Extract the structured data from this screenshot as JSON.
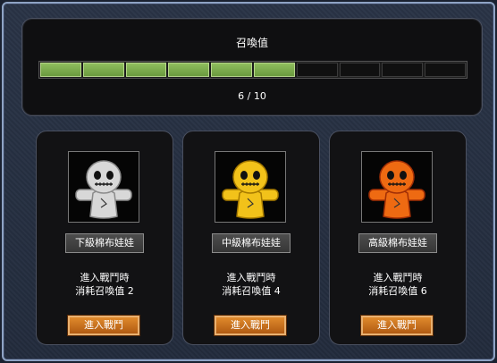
{
  "gauge": {
    "title": "召喚值",
    "filled": 6,
    "total": 10,
    "count_text": "6 / 10"
  },
  "cards": [
    {
      "name": "下級棉布娃娃",
      "line1": "進入戰鬥時",
      "line2": "消耗召喚值 2",
      "button": "進入戰鬥",
      "doll_color": "#d8d8d8",
      "doll_shade": "#8a8a8a"
    },
    {
      "name": "中級棉布娃娃",
      "line1": "進入戰鬥時",
      "line2": "消耗召喚值 4",
      "button": "進入戰鬥",
      "doll_color": "#f2c21a",
      "doll_shade": "#a67a00"
    },
    {
      "name": "高級棉布娃娃",
      "line1": "進入戰鬥時",
      "line2": "消耗召喚值 6",
      "button": "進入戰鬥",
      "doll_color": "#ee6a12",
      "doll_shade": "#a02e05"
    }
  ]
}
